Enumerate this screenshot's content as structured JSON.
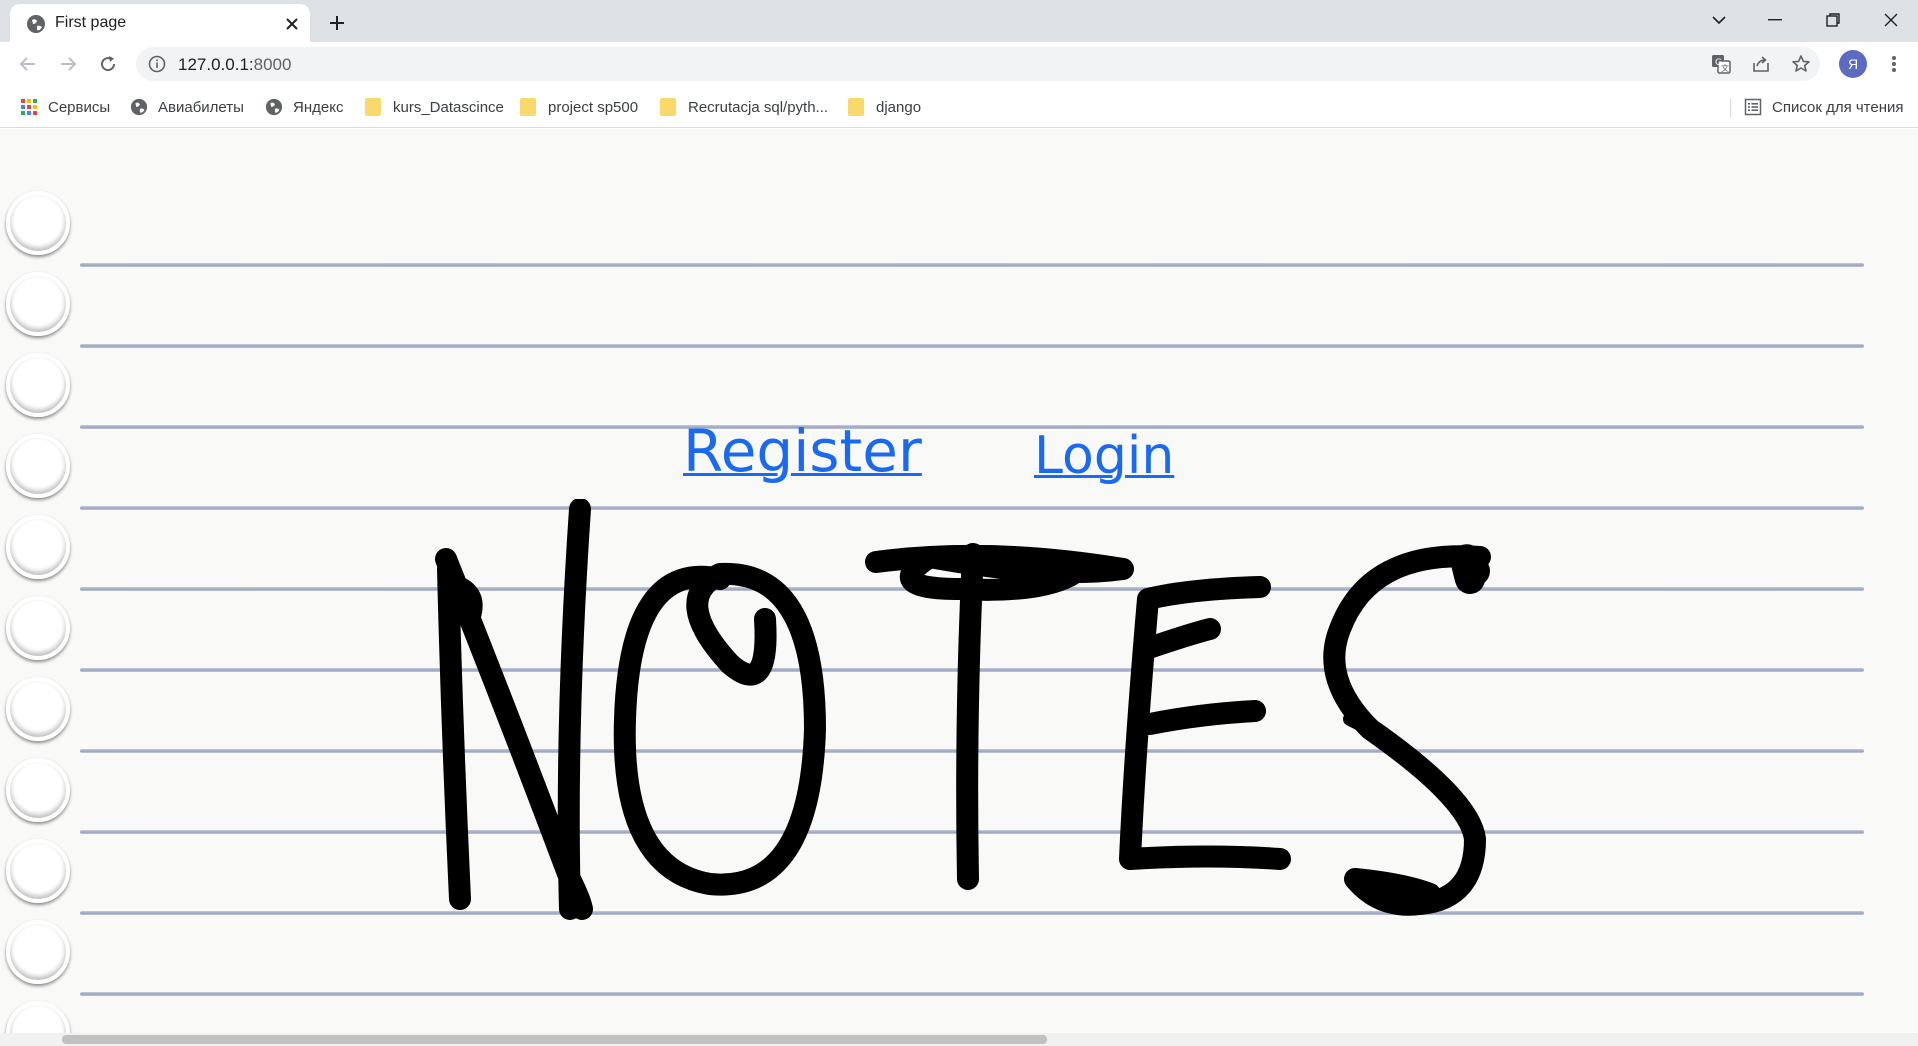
{
  "tab": {
    "title": "First page"
  },
  "toolbar": {
    "url_host": "127.0.0.1:",
    "url_port": "8000",
    "avatar_letter": "Я"
  },
  "bookmarks": [
    {
      "label": "Сервисы",
      "icon": "apps-grid-icon"
    },
    {
      "label": "Авиабилеты",
      "icon": "globe-icon"
    },
    {
      "label": "Яндекс",
      "icon": "globe-icon"
    },
    {
      "label": "kurs_Datascince",
      "icon": "folder-icon"
    },
    {
      "label": "project sp500",
      "icon": "folder-icon"
    },
    {
      "label": "Recrutacja sql/pyth...",
      "icon": "folder-icon"
    },
    {
      "label": "django",
      "icon": "folder-icon"
    }
  ],
  "reading_list": {
    "label": "Список для чтения"
  },
  "page": {
    "register_link": "Register",
    "login_link": "Login",
    "logo_text": "NOTES"
  },
  "colors": {
    "link": "#1a6af0",
    "rule_line": "#9aa3c0",
    "paper": "#f9f9f8"
  }
}
